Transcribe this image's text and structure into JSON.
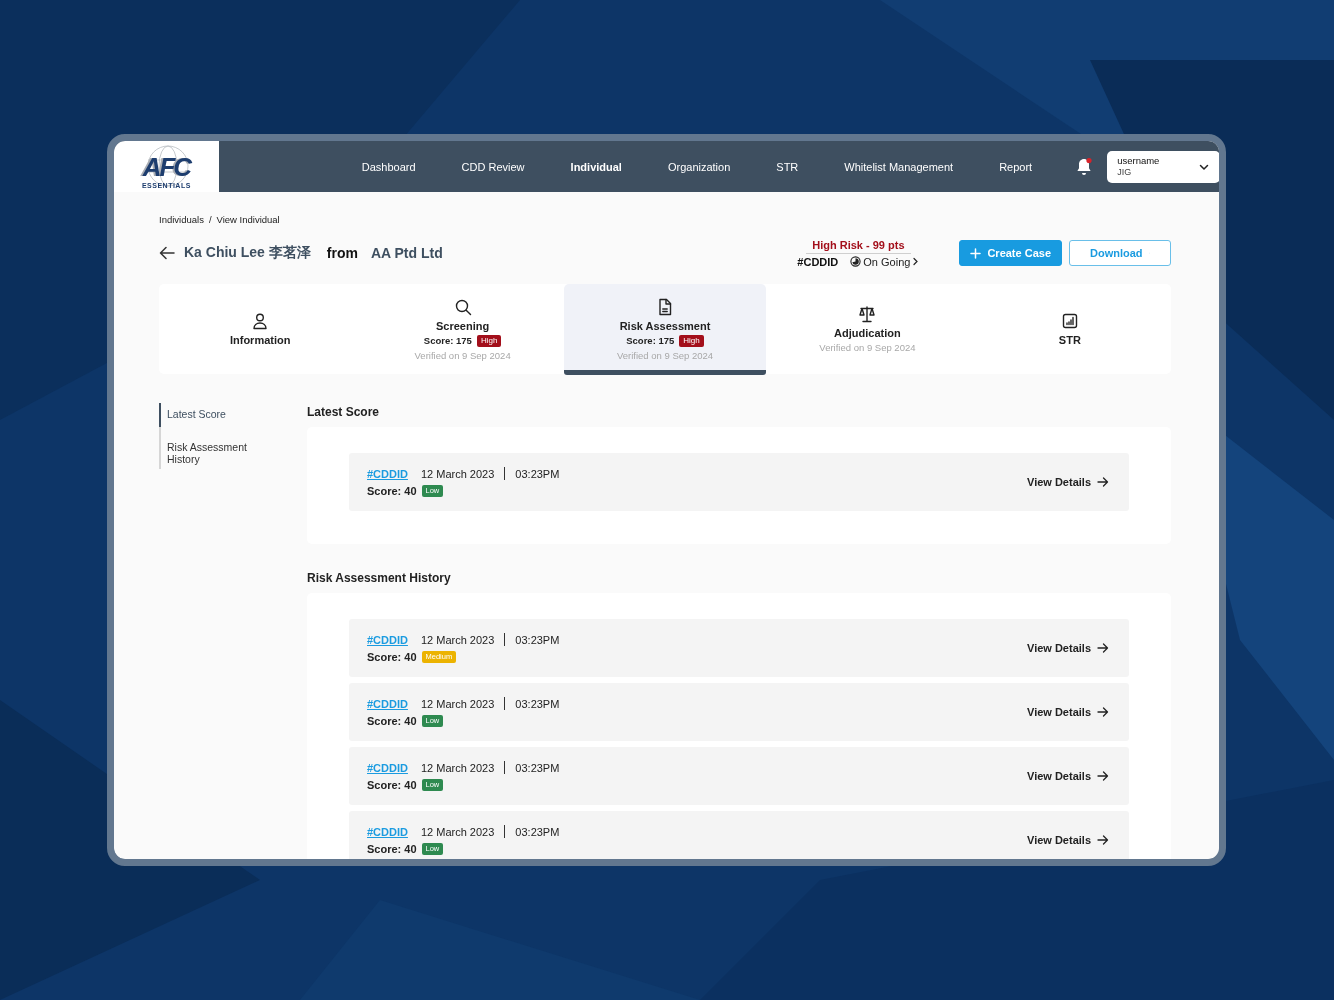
{
  "logo": {
    "mark": "AFC",
    "tagline": "ESSENTIALS"
  },
  "nav": [
    {
      "label": "Dashboard",
      "selected": false
    },
    {
      "label": "CDD Review",
      "selected": false
    },
    {
      "label": "Individual",
      "selected": true
    },
    {
      "label": "Organization",
      "selected": false
    },
    {
      "label": "STR",
      "selected": false
    },
    {
      "label": "Whitelist Management",
      "selected": false
    },
    {
      "label": "Report",
      "selected": false
    }
  ],
  "notifications": {
    "unread": true
  },
  "user": {
    "name": "username",
    "org": "JIG"
  },
  "breadcrumb": {
    "items": [
      "Individuals",
      "View Individual"
    ],
    "separator": "/"
  },
  "person": {
    "name": "Ka Chiu Lee 李茗泽",
    "from_label": "from",
    "company": "AA Ptd Ltd"
  },
  "risk": {
    "label": "High Risk - 99 pts",
    "case_id": "#CDDID",
    "status": "On Going"
  },
  "buttons": {
    "create": "Create Case",
    "download": "Download"
  },
  "tabs": [
    {
      "title": "Information",
      "selected": false
    },
    {
      "title": "Screening",
      "score": "Score: 175",
      "badge": {
        "text": "High",
        "color": "#a30f1b"
      },
      "verified": "Verified on 9 Sep 2024",
      "selected": false
    },
    {
      "title": "Risk Assessment",
      "score": "Score: 175",
      "badge": {
        "text": "High",
        "color": "#a30f1b"
      },
      "verified": "Verified on 9 Sep 2024",
      "selected": true
    },
    {
      "title": "Adjudication",
      "verified": "Verified on 9 Sep 2024",
      "selected": false
    },
    {
      "title": "STR",
      "selected": false
    }
  ],
  "sidebar": [
    {
      "label": "Latest Score",
      "selected": true
    },
    {
      "label": "Risk Assessment History",
      "selected": false
    }
  ],
  "sections": [
    {
      "title": "Latest Score",
      "records": [
        {
          "case_id": "#CDDID",
          "date": "12 March 2023",
          "time": "03:23PM",
          "score": "Score: 40",
          "badge": {
            "text": "Low",
            "color": "#2e8a50"
          },
          "action": "View Details"
        }
      ]
    },
    {
      "title": "Risk Assessment History",
      "records": [
        {
          "case_id": "#CDDID",
          "date": "12 March 2023",
          "time": "03:23PM",
          "score": "Score: 40",
          "badge": {
            "text": "Medium",
            "color": "#ecb300"
          },
          "action": "View Details"
        },
        {
          "case_id": "#CDDID",
          "date": "12 March 2023",
          "time": "03:23PM",
          "score": "Score: 40",
          "badge": {
            "text": "Low",
            "color": "#2e8a50"
          },
          "action": "View Details"
        },
        {
          "case_id": "#CDDID",
          "date": "12 March 2023",
          "time": "03:23PM",
          "score": "Score: 40",
          "badge": {
            "text": "Low",
            "color": "#2e8a50"
          },
          "action": "View Details"
        },
        {
          "case_id": "#CDDID",
          "date": "12 March 2023",
          "time": "03:23PM",
          "score": "Score: 40",
          "badge": {
            "text": "Low",
            "color": "#2e8a50"
          },
          "action": "View Details"
        }
      ]
    }
  ]
}
